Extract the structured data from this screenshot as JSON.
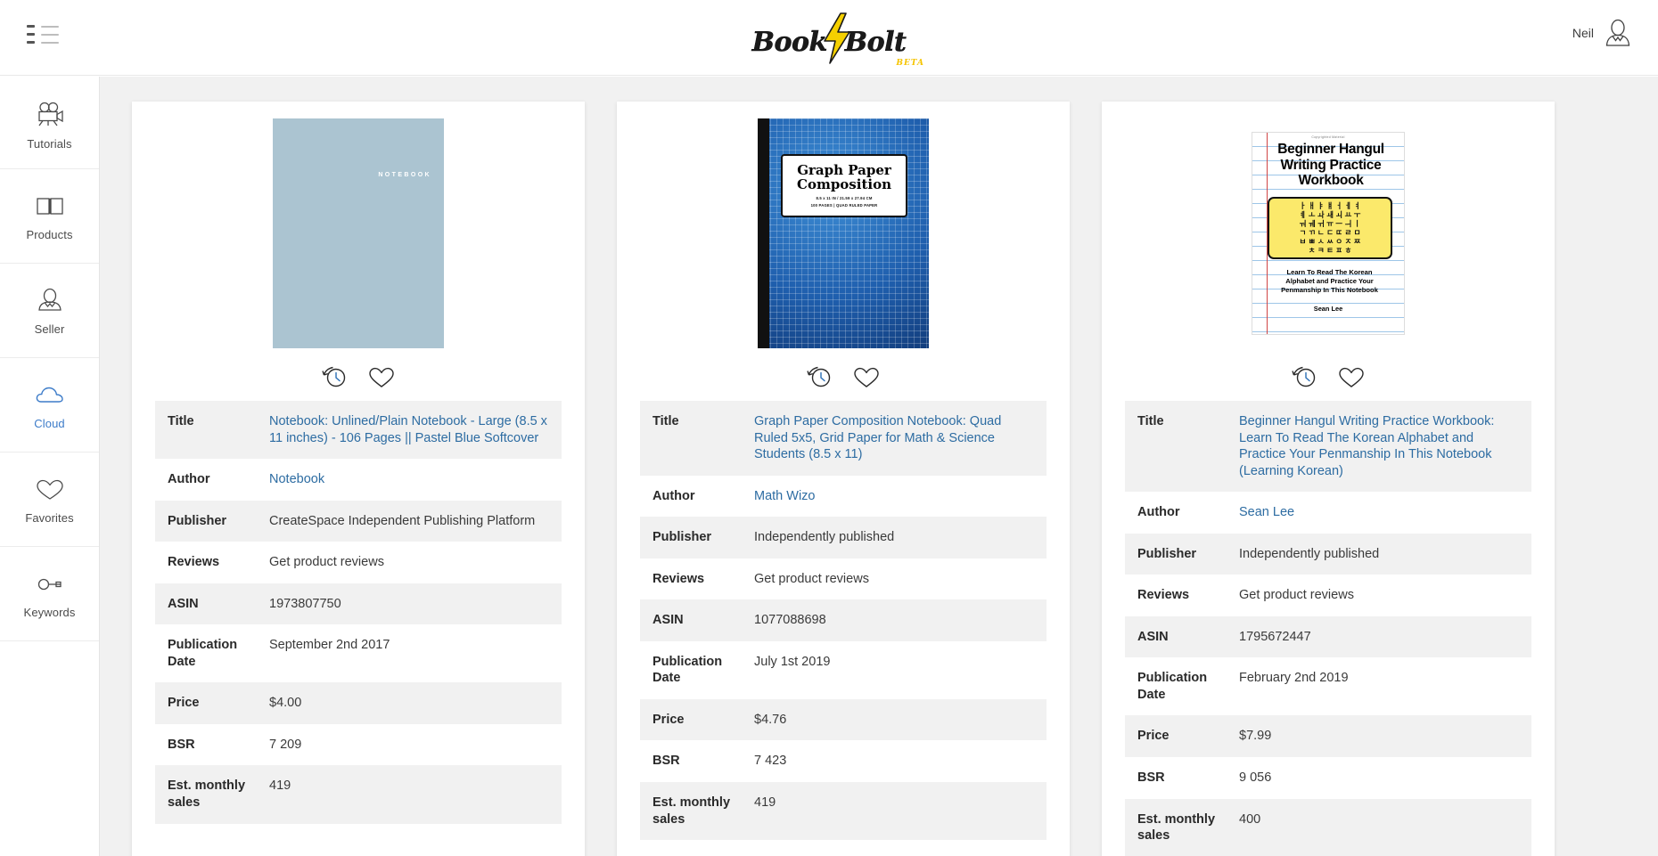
{
  "header": {
    "menu_icon": "list-menu-icon",
    "logo": {
      "text": "BookBolt",
      "word_left": "Book",
      "word_right": "Bolt",
      "badge": "BETA",
      "bolt_color": "#f5d000"
    },
    "user": {
      "name": "Neil",
      "avatar_icon": "user-avatar-icon"
    }
  },
  "sidebar": {
    "active_index": 3,
    "items": [
      {
        "label": "Tutorials",
        "icon": "video-camera-icon"
      },
      {
        "label": "Products",
        "icon": "open-book-icon"
      },
      {
        "label": "Seller",
        "icon": "person-icon"
      },
      {
        "label": "Cloud",
        "icon": "cloud-icon"
      },
      {
        "label": "Favorites",
        "icon": "heart-icon"
      },
      {
        "label": "Keywords",
        "icon": "key-icon"
      }
    ],
    "active_color": "#3d7cc9"
  },
  "labels": {
    "title": "Title",
    "author": "Author",
    "publisher": "Publisher",
    "reviews": "Reviews",
    "asin": "ASIN",
    "publication_date": "Publication Date",
    "price": "Price",
    "bsr": "BSR",
    "est_monthly_sales_l1": "Est. monthly",
    "est_monthly_sales_l2": "sales"
  },
  "actions": {
    "history_icon": "history-restore-icon",
    "favorite_icon": "heart-outline-icon"
  },
  "cards": [
    {
      "cover": {
        "kind": "plain",
        "bg_color": "#abc4d1",
        "word": "NOTEBOOK"
      },
      "title": "Notebook: Unlined/Plain Notebook - Large (8.5 x 11 inches) - 106 Pages || Pastel Blue Softcover",
      "author": "Notebook",
      "publisher": "CreateSpace Independent Publishing Platform",
      "reviews": "Get product reviews",
      "asin": "1973807750",
      "publication_date": "September 2nd 2017",
      "price": "$4.00",
      "bsr": "7 209",
      "est_monthly_sales": "419"
    },
    {
      "cover": {
        "kind": "graph",
        "label_line1": "Graph Paper",
        "label_line2": "Composition",
        "label_small1": "8.5 x 11 IN / 21.59 x 27.94 CM",
        "label_small2": "100 PAGES | QUAD RULED PAPER"
      },
      "title": "Graph Paper Composition Notebook: Quad Ruled 5x5, Grid Paper for Math & Science Students (8.5 x 11)",
      "author": "Math Wizo",
      "publisher": "Independently published",
      "reviews": "Get product reviews",
      "asin": "1077088698",
      "publication_date": "July 1st 2019",
      "price": "$4.76",
      "bsr": "7 423",
      "est_monthly_sales": "419"
    },
    {
      "cover": {
        "kind": "hangul",
        "copyright_note": "Copyrighted Material",
        "title_line1": "Beginner Hangul",
        "title_line2": "Writing Practice",
        "title_line3": "Workbook",
        "hangul_rows": [
          "ㅏ ㅐ ㅑ ㅒ ㅓ ㅔ ㅕ",
          "ㅖ ㅗ ㅘ ㅙ ㅚ ㅛ ㅜ",
          "ㅝ ㅞ ㅟ ㅠ ㅡ ㅢ ㅣ",
          "ㄱ ㄲ ㄴ ㄷ ㄸ ㄹ ㅁ",
          "ㅂ ㅃ ㅅ ㅆ ㅇ ㅈ ㅉ",
          "ㅊ ㅋ ㅌ ㅍ ㅎ"
        ],
        "sub_line1": "Learn To Read The Korean",
        "sub_line2": "Alphabet and Practice Your",
        "sub_line3": "Penmanship In This Notebook",
        "author_name": "Sean Lee"
      },
      "title": "Beginner Hangul Writing Practice Workbook: Learn To Read The Korean Alphabet and Practice Your Penmanship In This Notebook (Learning Korean)",
      "author": "Sean Lee",
      "publisher": "Independently published",
      "reviews": "Get product reviews",
      "asin": "1795672447",
      "publication_date": "February 2nd 2019",
      "price": "$7.99",
      "bsr": "9 056",
      "est_monthly_sales": "400"
    }
  ]
}
